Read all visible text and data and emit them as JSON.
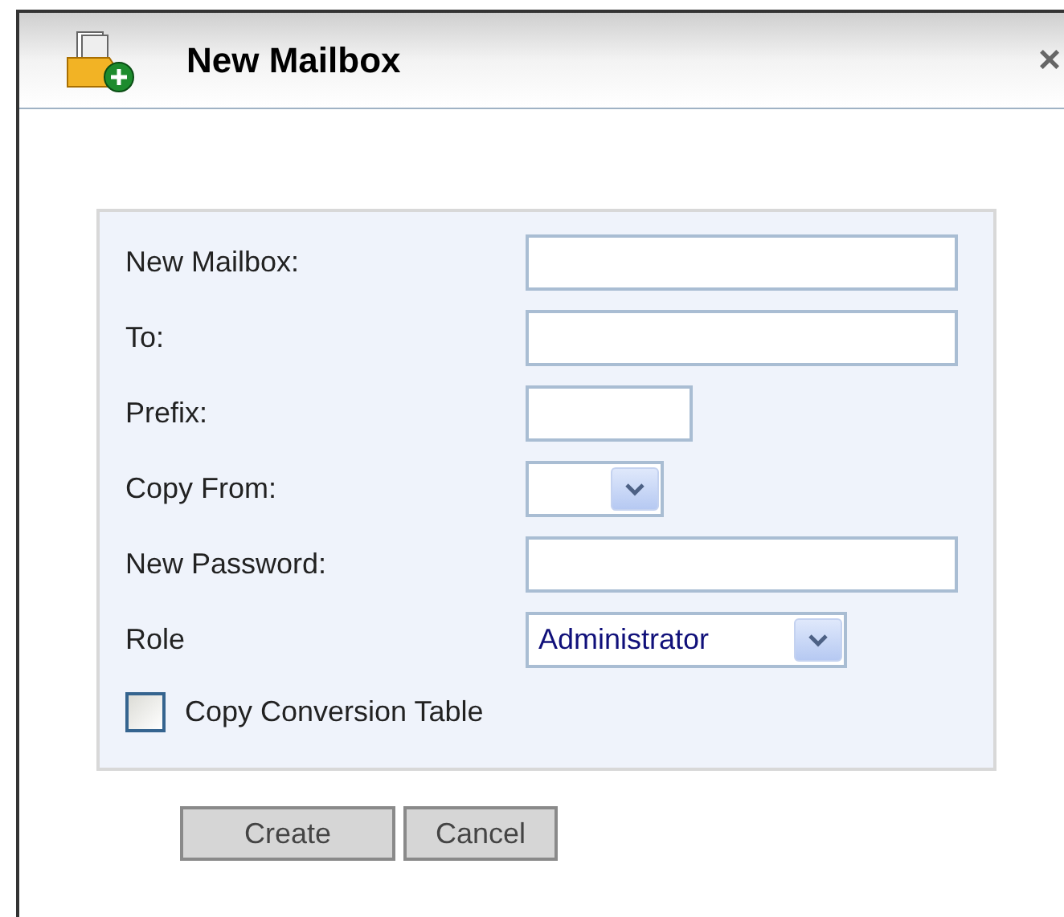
{
  "window": {
    "title": "New Mailbox",
    "close": "×"
  },
  "fields": [
    {
      "label": "New Mailbox:",
      "kind": "wide_text"
    },
    {
      "label": "To:",
      "kind": "wide_text"
    },
    {
      "label": "Prefix:",
      "kind": "short_text"
    },
    {
      "label": "Copy From:",
      "kind": "small_select"
    },
    {
      "label": "New Password:",
      "kind": "wide_text"
    },
    {
      "label": "Role",
      "kind": "select",
      "value": "Administrator"
    }
  ],
  "checkbox": {
    "label": "Copy Conversion Table",
    "checked": false
  },
  "buttons": [
    "Create",
    "Cancel"
  ]
}
